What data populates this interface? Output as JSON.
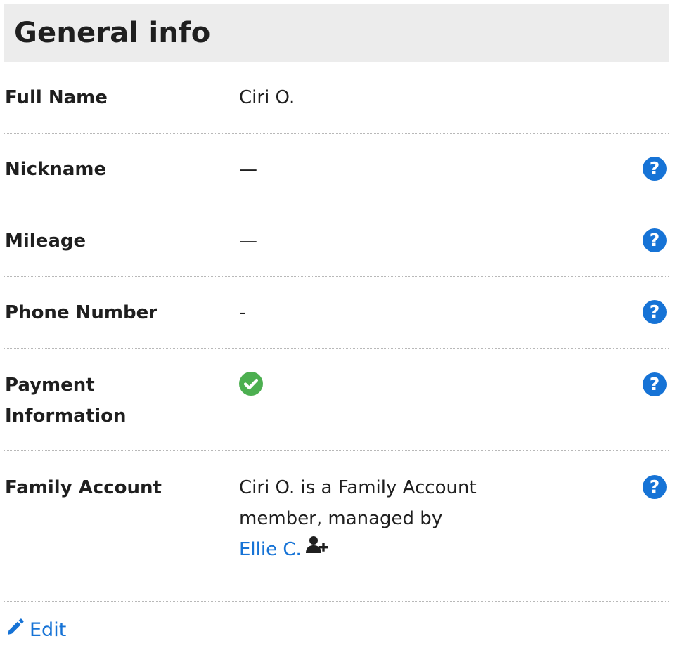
{
  "panel": {
    "title": "General info"
  },
  "rows": [
    {
      "label": "Full Name",
      "value": "Ciri O.",
      "help": false
    },
    {
      "label": "Nickname",
      "value": "—",
      "help": true
    },
    {
      "label": "Mileage",
      "value": "—",
      "help": true
    },
    {
      "label": "Phone Number",
      "value": "-",
      "help": true
    },
    {
      "label": "Payment Information",
      "value_icon": "check-circle-icon",
      "help": true
    },
    {
      "label": "Family Account",
      "value_text": "Ciri O. is a Family Account member, managed by",
      "manager_link": "Ellie C.",
      "manager_icon": "user-plus-icon",
      "help": true
    }
  ],
  "help_icon_glyph": "?",
  "edit": {
    "label": "Edit",
    "icon": "pencil-icon"
  },
  "colors": {
    "accent_blue": "#1673d6",
    "success_green": "#4caf50",
    "header_bg": "#ececec"
  }
}
